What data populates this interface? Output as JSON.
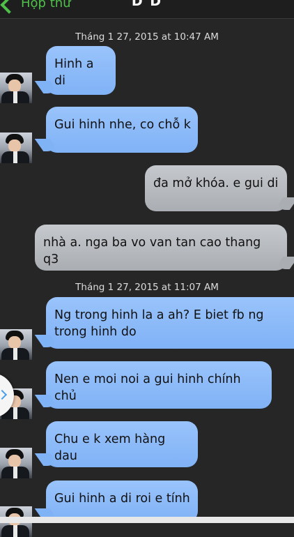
{
  "header": {
    "back_label": "Hộp thư",
    "title": "D D"
  },
  "timestamps": [
    "Tháng 1 27, 2015 at 10:47 AM",
    "Tháng 1 27, 2015 at 11:07 AM"
  ],
  "messages": [
    {
      "direction": "incoming",
      "text": "Hinh a di"
    },
    {
      "direction": "incoming",
      "text": "Gui hinh nhe, co chỗ k"
    },
    {
      "direction": "outgoing",
      "text": "đa mở khóa. e gui di"
    },
    {
      "direction": "outgoing",
      "text": "nhà a. nga ba vo van tan cao thang q3"
    },
    {
      "direction": "incoming",
      "text": "Ng trong hinh la a ah? E biet fb ng trong hinh do"
    },
    {
      "direction": "incoming",
      "text": "Nen e moi noi a gui hinh chính chủ"
    },
    {
      "direction": "incoming",
      "text": "Chu e k xem hàng dau"
    },
    {
      "direction": "incoming",
      "text": "Gui hinh a di roi e tính"
    }
  ],
  "colors": {
    "background": "#262626",
    "incoming_bubble": "#8bb9f8",
    "outgoing_bubble": "#b8bbbf",
    "accent": "#4fc04a"
  },
  "icons": {
    "back": "chevron-left-icon",
    "side_handle": "chevron-right-icon"
  }
}
